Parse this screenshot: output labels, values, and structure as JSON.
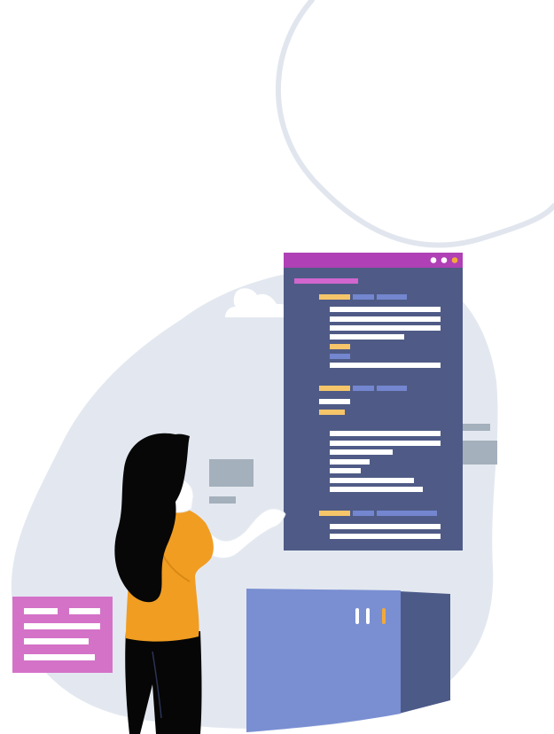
{
  "illustration": {
    "subject": "developer-at-code-window",
    "icons": {
      "cloud": "cloud-icon",
      "window_controls": "window-dots-icon"
    },
    "colors": {
      "background": "#ffffff",
      "blob": "#e3e8f0",
      "loop_stroke": "#e1e6ee",
      "window_body": "#4f5b86",
      "window_titlebar": "#b040b5",
      "code_white": "#ffffff",
      "code_yellow": "#f6c56a",
      "code_blue": "#7386cf",
      "code_pink": "#d166cf",
      "dot_orange": "#f3a93a",
      "gray_panel": "#a4b0bc",
      "pink_note": "#d472c8",
      "server_front": "#7a8fd2",
      "server_side": "#4c5a88",
      "shirt": "#f09d22",
      "hair": "#070707",
      "skin": "#ffffff",
      "pants": "#060606"
    }
  }
}
